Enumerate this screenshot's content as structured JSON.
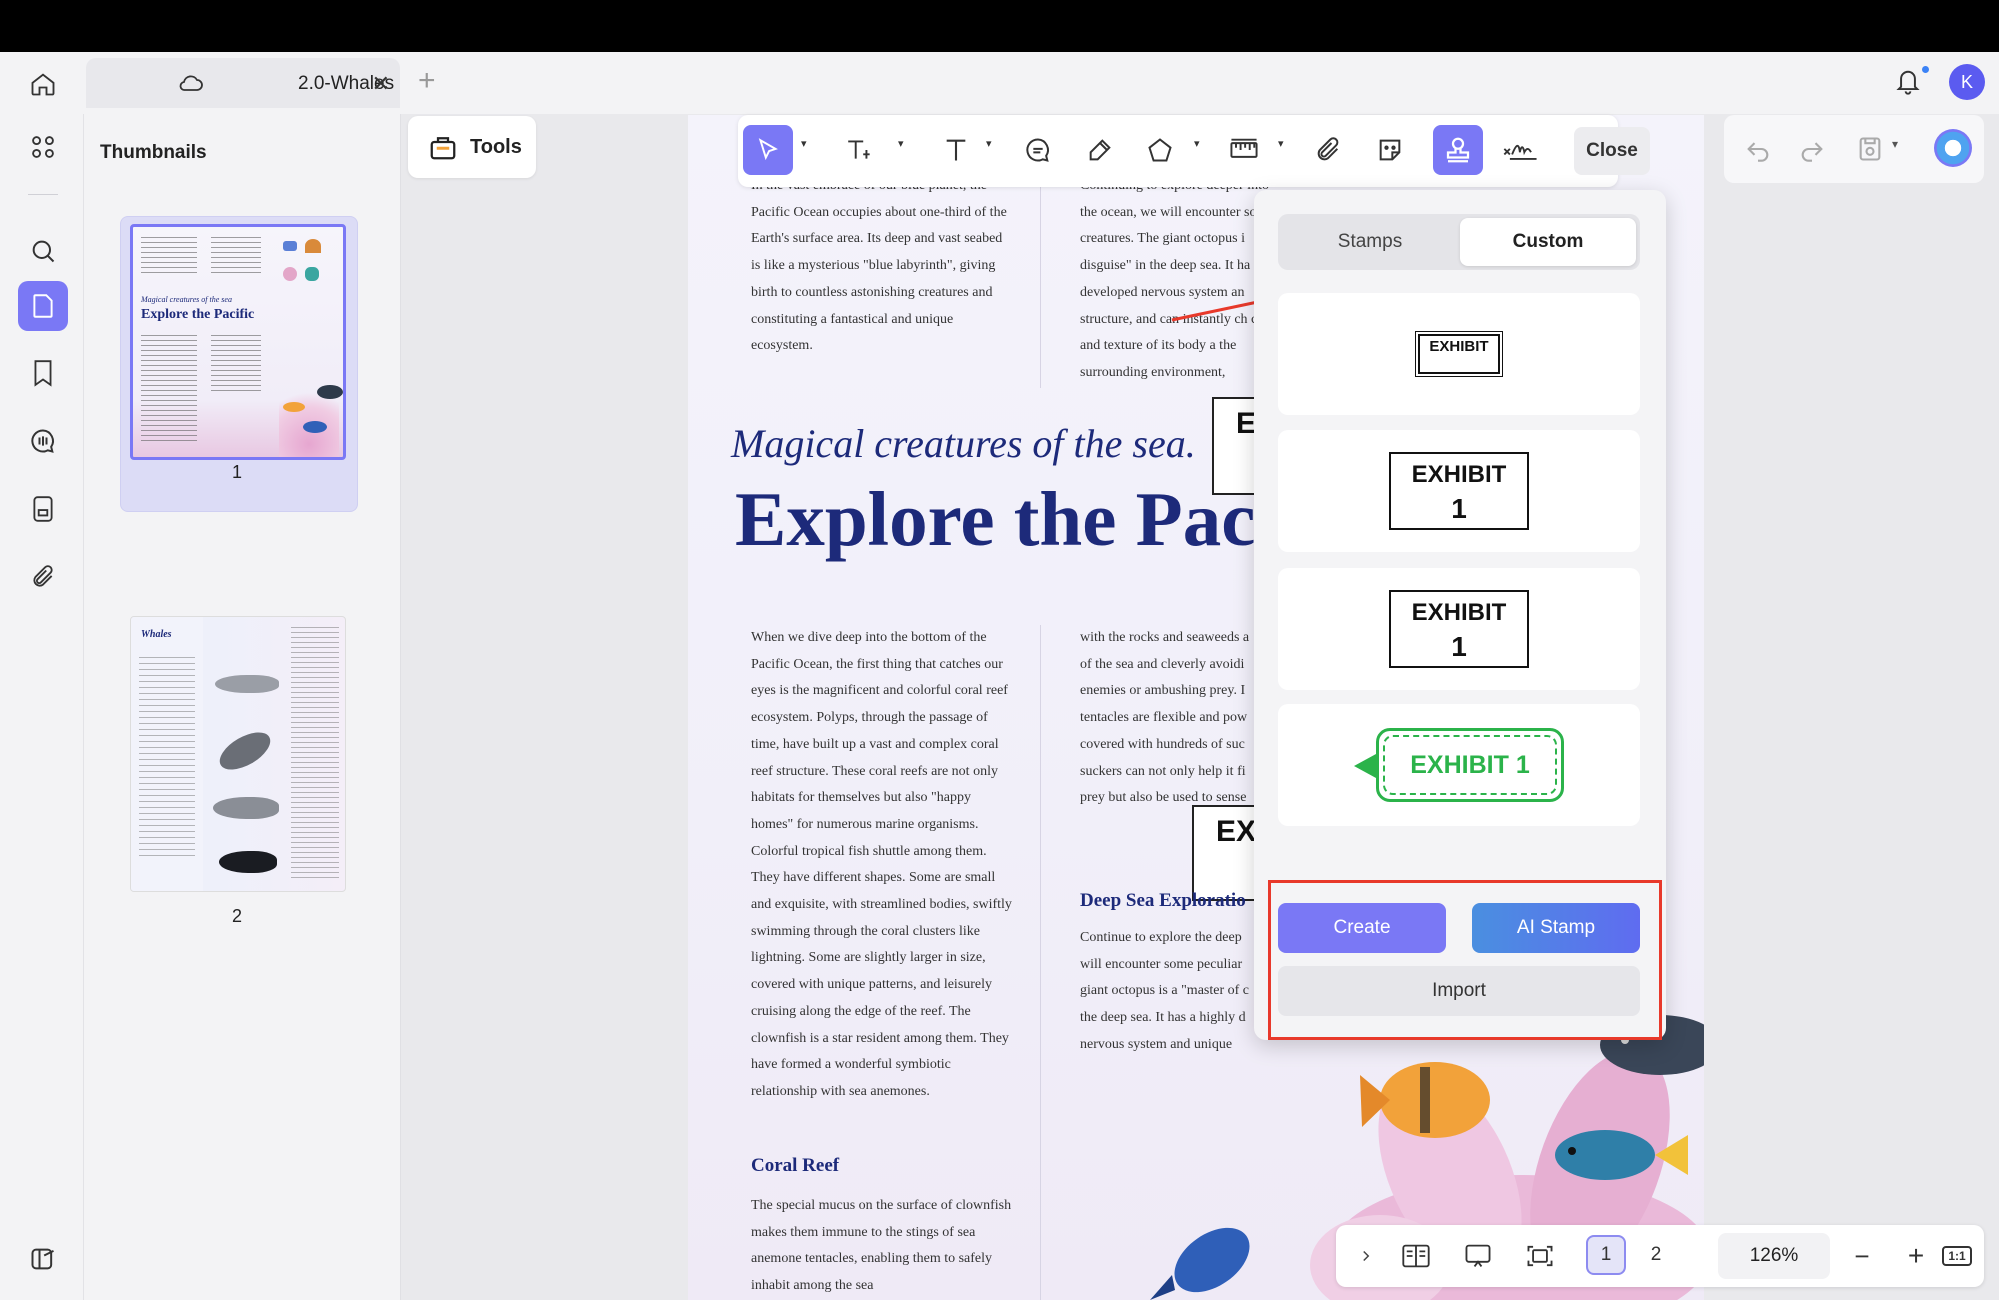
{
  "tab": {
    "title": "2.0-Whales"
  },
  "user": {
    "initial": "K"
  },
  "thumbnails": {
    "heading": "Thumbnails",
    "pages": [
      {
        "label": "1",
        "mini_title": "Explore the Pacific",
        "mini_sub": "Magical creatures of the sea"
      },
      {
        "label": "2",
        "mini_title": "Whales"
      }
    ]
  },
  "tools_button": {
    "label": "Tools"
  },
  "toolbar": {
    "close_label": "Close"
  },
  "document": {
    "col1_top": "In the vast embrace of our blue planet, the Pacific Ocean occupies about one-third of the Earth's surface area. Its deep and vast seabed is like a mysterious \"blue labyrinth\", giving birth to countless astonishing creatures and constituting a fantastical and unique ecosystem.",
    "col2_top": "Continuing to explore deeper into the ocean, we will encounter som creatures. The giant octopus i disguise\" in the deep sea. It ha developed nervous system an structure, and can instantly ch color and texture of its body a the surrounding environment,",
    "subtitle": "Magical creatures of the sea.",
    "title": "Explore the Pac",
    "col1_body": "When we dive deep into the bottom of the Pacific Ocean, the first thing that catches our eyes is the magnificent and colorful coral reef ecosystem. Polyps, through the passage of time, have built up a vast and complex coral reef structure. These coral reefs are not only habitats for themselves but also \"happy homes\" for numerous marine organisms. Colorful tropical fish shuttle among them. They have different shapes. Some are small and exquisite, with streamlined bodies, swiftly swimming through the coral clusters like lightning. Some are slightly larger in size, covered with unique patterns, and leisurely cruising along the edge of the reef. The clownfish is a star resident among them. They have formed a wonderful symbiotic relationship with sea anemones.",
    "col2_body": "with the rocks and seaweeds a of the sea and cleverly avoidi enemies or ambushing prey. I tentacles are flexible and pow covered with hundreds of suc suckers can not only help it fi prey but also be used to sense surrounding environ",
    "coral_heading": "Coral Reef",
    "coral_body": "The special mucus on the surface of clownfish makes them immune to the stings of sea anemone tentacles, enabling them to safely inhabit among the sea",
    "deep_heading": "Deep Sea Exploratio",
    "deep_body": "Continue to explore the deep will encounter some peculiar giant octopus is a \"master of c the deep sea. It has a highly d nervous system and unique body structure.",
    "stamp_fragment_1": "E",
    "stamp_fragment_2": "EX"
  },
  "stamp_panel": {
    "tabs": [
      "Stamps",
      "Custom"
    ],
    "active_tab": "Custom",
    "stamps": [
      {
        "style": "small-outline",
        "text": "EXHIBIT"
      },
      {
        "style": "box",
        "line1": "EXHIBIT",
        "line2": "1"
      },
      {
        "style": "box",
        "line1": "EXHIBIT",
        "line2": "1"
      },
      {
        "style": "green-tag",
        "text": "EXHIBIT 1",
        "color": "#2bb34a"
      }
    ],
    "create_label": "Create",
    "ai_label": "AI Stamp",
    "import_label": "Import",
    "highlight_color": "#e8392b"
  },
  "bottom_bar": {
    "pages": [
      "1",
      "2"
    ],
    "current_page": "1",
    "zoom": "126%",
    "fit_label": "1:1"
  },
  "colors": {
    "accent": "#7a78f5",
    "heading_navy": "#1d2a7a",
    "annotation_red": "#e8392b"
  }
}
